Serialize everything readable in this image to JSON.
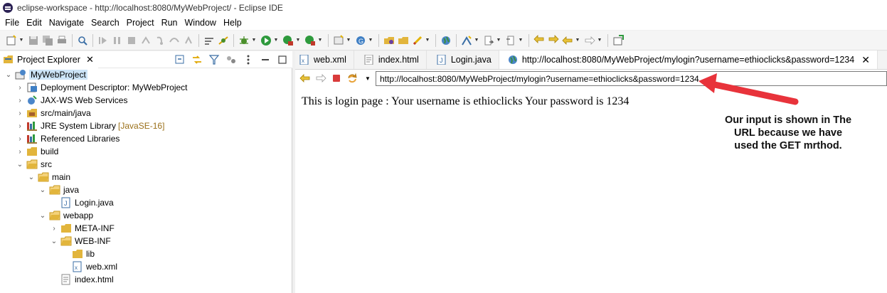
{
  "window": {
    "title": "eclipse-workspace - http://localhost:8080/MyWebProject/ - Eclipse IDE"
  },
  "menu": [
    "File",
    "Edit",
    "Navigate",
    "Search",
    "Project",
    "Run",
    "Window",
    "Help"
  ],
  "explorer": {
    "tab_label": "Project Explorer",
    "tree": [
      {
        "label": "MyWebProject",
        "icon": "web-project-icon",
        "expanded": true,
        "selected": true
      },
      {
        "label": "Deployment Descriptor: MyWebProject",
        "icon": "deployment-descriptor-icon",
        "expanded": false
      },
      {
        "label": "JAX-WS Web Services",
        "icon": "web-services-icon",
        "expanded": false
      },
      {
        "label": "src/main/java",
        "icon": "source-folder-icon",
        "expanded": false
      },
      {
        "label": "JRE System Library",
        "extra": "[JavaSE-16]",
        "icon": "library-icon",
        "expanded": false
      },
      {
        "label": "Referenced Libraries",
        "icon": "library-icon",
        "expanded": false
      },
      {
        "label": "build",
        "icon": "folder-icon",
        "expanded": false
      },
      {
        "label": "src",
        "icon": "folder-open-icon",
        "expanded": true
      },
      {
        "label": "main",
        "icon": "folder-open-icon",
        "expanded": true
      },
      {
        "label": "java",
        "icon": "folder-open-icon",
        "expanded": true
      },
      {
        "label": "Login.java",
        "icon": "java-file-icon"
      },
      {
        "label": "webapp",
        "icon": "folder-open-icon",
        "expanded": true
      },
      {
        "label": "META-INF",
        "icon": "folder-icon",
        "expanded": false
      },
      {
        "label": "WEB-INF",
        "icon": "folder-open-icon",
        "expanded": true
      },
      {
        "label": "lib",
        "icon": "folder-icon"
      },
      {
        "label": "web.xml",
        "icon": "xml-file-icon"
      },
      {
        "label": "index.html",
        "icon": "html-file-icon"
      }
    ]
  },
  "editor": {
    "tabs": [
      {
        "label": "web.xml",
        "icon": "xml-file-icon",
        "active": false
      },
      {
        "label": "index.html",
        "icon": "html-file-icon",
        "active": false
      },
      {
        "label": "Login.java",
        "icon": "java-file-icon",
        "active": false
      },
      {
        "label": "http://localhost:8080/MyWebProject/mylogin?username=ethioclicks&password=1234",
        "icon": "globe-icon",
        "active": true
      }
    ],
    "url": "http://localhost:8080/MyWebProject/mylogin?username=ethioclicks&password=1234",
    "page_text": "This is login page : Your username is ethioclicks Your password is 1234"
  },
  "annotation": {
    "text": "Our input is shown in The URL because we have used the GET mrthod.",
    "color": "#e8333b"
  },
  "colors": {
    "selection": "#cce4f7",
    "library_extra": "#9a6f18"
  }
}
